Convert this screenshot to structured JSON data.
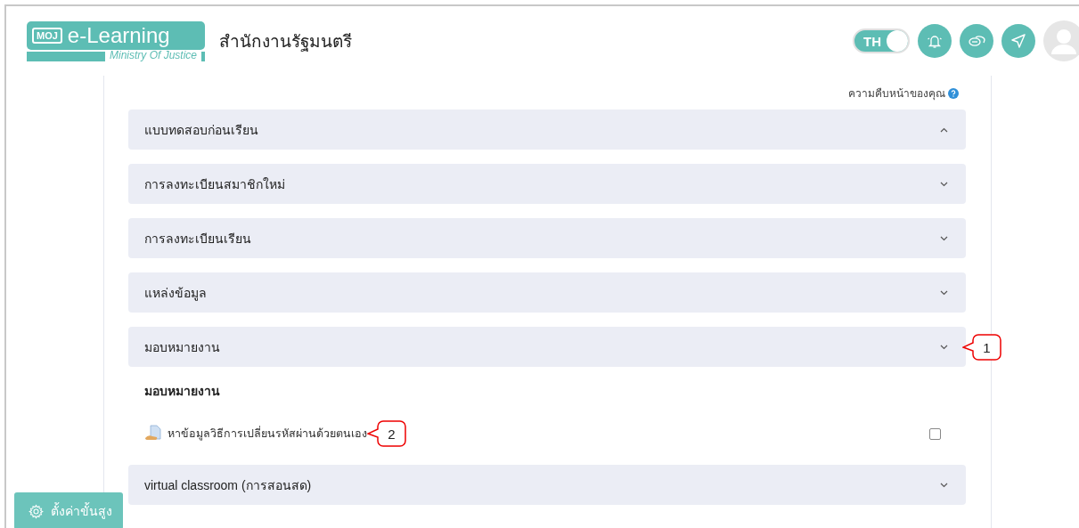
{
  "header": {
    "logo": {
      "badge": "MOJ",
      "title": "e-Learning",
      "subtitle": "Ministry Of Justice"
    },
    "site_name": "สำนักงานรัฐมนตรี",
    "language_toggle": {
      "label": "TH",
      "on": true
    }
  },
  "progress_label": "ความคืบหน้าของคุณ",
  "sections": [
    {
      "title": "แบบทดสอบก่อนเรียน",
      "expanded": true
    },
    {
      "title": "การลงทะเบียนสมาชิกใหม่",
      "expanded": false
    },
    {
      "title": "การลงทะเบียนเรียน",
      "expanded": false
    },
    {
      "title": "แหล่งข้อมูล",
      "expanded": false
    },
    {
      "title": "มอบหมายงาน",
      "expanded": false,
      "content": {
        "heading": "มอบหมายงาน",
        "activities": [
          {
            "title": "หาข้อมูลวิธีการเปลี่ยนรหัสผ่านด้วยตนเอง",
            "checked": false
          }
        ]
      }
    },
    {
      "title": "virtual classroom (การสอนสด)",
      "expanded": false
    }
  ],
  "callouts": [
    {
      "label": "1"
    },
    {
      "label": "2"
    }
  ],
  "settings_button": "ตั้งค่าขั้นสูง"
}
